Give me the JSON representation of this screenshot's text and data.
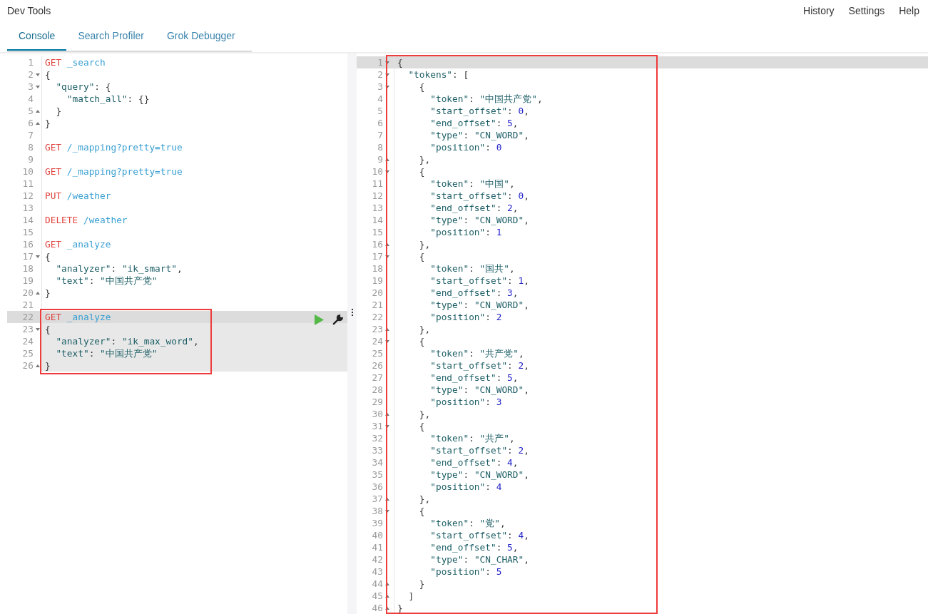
{
  "app": {
    "title": "Dev Tools",
    "links": [
      "History",
      "Settings",
      "Help"
    ]
  },
  "tabs": [
    {
      "label": "Console",
      "selected": true
    },
    {
      "label": "Search Profiler",
      "selected": false
    },
    {
      "label": "Grok Debugger",
      "selected": false
    }
  ],
  "editors": [
    {
      "kind": "input",
      "blocks": [
        {
          "highlighted": false,
          "boxed": false,
          "lines": [
            {
              "n": "1",
              "kind": "plain",
              "active": false,
              "segs": [
                {
                  "kind": "method",
                  "text": "GET"
                },
                {
                  "kind": "url",
                  "text": " _search"
                }
              ]
            },
            {
              "n": "2",
              "kind": "opener",
              "active": false,
              "segs": [
                {
                  "kind": "punct",
                  "text": "{"
                }
              ]
            },
            {
              "n": "3",
              "kind": "opener",
              "active": false,
              "segs": [
                {
                  "kind": "key",
                  "text": "  \"query\""
                },
                {
                  "kind": "punct",
                  "text": ": {"
                }
              ]
            },
            {
              "n": "4",
              "kind": "plain",
              "active": false,
              "segs": [
                {
                  "kind": "key",
                  "text": "    \"match_all\""
                },
                {
                  "kind": "punct",
                  "text": ": {}"
                }
              ]
            },
            {
              "n": "5",
              "kind": "closer",
              "active": false,
              "segs": [
                {
                  "kind": "punct",
                  "text": "  }"
                }
              ]
            },
            {
              "n": "6",
              "kind": "closer",
              "active": false,
              "segs": [
                {
                  "kind": "punct",
                  "text": "}"
                }
              ]
            },
            {
              "n": "7",
              "kind": "plain",
              "active": false
            },
            {
              "n": "8",
              "kind": "plain",
              "active": false,
              "segs": [
                {
                  "kind": "method",
                  "text": "GET"
                },
                {
                  "kind": "url",
                  "text": " /_mapping?pretty=true"
                }
              ]
            },
            {
              "n": "9",
              "kind": "plain",
              "active": false
            },
            {
              "n": "10",
              "kind": "plain",
              "active": false,
              "segs": [
                {
                  "kind": "method",
                  "text": "GET"
                },
                {
                  "kind": "url",
                  "text": " /_mapping?pretty=true"
                }
              ]
            },
            {
              "n": "11",
              "kind": "plain",
              "active": false
            },
            {
              "n": "12",
              "kind": "plain",
              "active": false,
              "segs": [
                {
                  "kind": "method",
                  "text": "PUT"
                },
                {
                  "kind": "url",
                  "text": " /weather"
                }
              ]
            },
            {
              "n": "13",
              "kind": "plain",
              "active": false
            },
            {
              "n": "14",
              "kind": "plain",
              "active": false,
              "segs": [
                {
                  "kind": "method",
                  "text": "DELETE"
                },
                {
                  "kind": "url",
                  "text": " /weather"
                }
              ]
            },
            {
              "n": "15",
              "kind": "plain",
              "active": false
            },
            {
              "n": "16",
              "kind": "plain",
              "active": false,
              "segs": [
                {
                  "kind": "method",
                  "text": "GET"
                },
                {
                  "kind": "url",
                  "text": " _analyze"
                }
              ]
            },
            {
              "n": "17",
              "kind": "opener",
              "active": false,
              "segs": [
                {
                  "kind": "punct",
                  "text": "{"
                }
              ]
            },
            {
              "n": "18",
              "kind": "plain",
              "active": false,
              "segs": [
                {
                  "kind": "key",
                  "text": "  \"analyzer\""
                },
                {
                  "kind": "punct",
                  "text": ": "
                },
                {
                  "kind": "string",
                  "text": "\"ik_smart\""
                },
                {
                  "kind": "punct",
                  "text": ","
                }
              ]
            },
            {
              "n": "19",
              "kind": "plain",
              "active": false,
              "segs": [
                {
                  "kind": "key",
                  "text": "  \"text\""
                },
                {
                  "kind": "punct",
                  "text": ": "
                },
                {
                  "kind": "string",
                  "text": "\"中国共产党\""
                }
              ]
            },
            {
              "n": "20",
              "kind": "closer",
              "active": false,
              "segs": [
                {
                  "kind": "punct",
                  "text": "}"
                }
              ]
            },
            {
              "n": "21",
              "kind": "plain",
              "active": false
            }
          ]
        },
        {
          "highlighted": true,
          "boxed": true,
          "lines": [
            {
              "n": "22",
              "kind": "plain",
              "active": true,
              "segs": [
                {
                  "kind": "method",
                  "text": "GET"
                },
                {
                  "kind": "url",
                  "text": " _analyze"
                }
              ]
            },
            {
              "n": "23",
              "kind": "opener",
              "active": false,
              "segs": [
                {
                  "kind": "punct",
                  "text": "{"
                }
              ]
            },
            {
              "n": "24",
              "kind": "plain",
              "active": false,
              "segs": [
                {
                  "kind": "key",
                  "text": "  \"analyzer\""
                },
                {
                  "kind": "punct",
                  "text": ": "
                },
                {
                  "kind": "string",
                  "text": "\"ik_max_word\""
                },
                {
                  "kind": "punct",
                  "text": ","
                }
              ]
            },
            {
              "n": "25",
              "kind": "plain",
              "active": false,
              "segs": [
                {
                  "kind": "key",
                  "text": "  \"text\""
                },
                {
                  "kind": "punct",
                  "text": ": "
                },
                {
                  "kind": "string",
                  "text": "\"中国共产党\""
                }
              ]
            },
            {
              "n": "26",
              "kind": "closer",
              "active": false,
              "segs": [
                {
                  "kind": "punct",
                  "text": "}"
                }
              ]
            }
          ]
        }
      ]
    },
    {
      "kind": "output",
      "blocks": [
        {
          "highlighted": false,
          "boxed": true,
          "lines": [
            {
              "n": "1",
              "kind": "opener",
              "active": true,
              "segs": [
                {
                  "kind": "punct",
                  "text": "{"
                }
              ]
            },
            {
              "n": "2",
              "kind": "opener",
              "active": false,
              "segs": [
                {
                  "kind": "key",
                  "text": "  \"tokens\""
                },
                {
                  "kind": "punct",
                  "text": ": ["
                }
              ]
            },
            {
              "n": "3",
              "kind": "opener",
              "active": false,
              "segs": [
                {
                  "kind": "punct",
                  "text": "    {"
                }
              ]
            },
            {
              "n": "4",
              "kind": "plain",
              "active": false,
              "segs": [
                {
                  "kind": "key",
                  "text": "      \"token\""
                },
                {
                  "kind": "punct",
                  "text": ": "
                },
                {
                  "kind": "string",
                  "text": "\"中国共产党\""
                },
                {
                  "kind": "punct",
                  "text": ","
                }
              ]
            },
            {
              "n": "5",
              "kind": "plain",
              "active": false,
              "segs": [
                {
                  "kind": "key",
                  "text": "      \"start_offset\""
                },
                {
                  "kind": "punct",
                  "text": ": "
                },
                {
                  "kind": "number",
                  "text": "0"
                },
                {
                  "kind": "punct",
                  "text": ","
                }
              ]
            },
            {
              "n": "6",
              "kind": "plain",
              "active": false,
              "segs": [
                {
                  "kind": "key",
                  "text": "      \"end_offset\""
                },
                {
                  "kind": "punct",
                  "text": ": "
                },
                {
                  "kind": "number",
                  "text": "5"
                },
                {
                  "kind": "punct",
                  "text": ","
                }
              ]
            },
            {
              "n": "7",
              "kind": "plain",
              "active": false,
              "segs": [
                {
                  "kind": "key",
                  "text": "      \"type\""
                },
                {
                  "kind": "punct",
                  "text": ": "
                },
                {
                  "kind": "string",
                  "text": "\"CN_WORD\""
                },
                {
                  "kind": "punct",
                  "text": ","
                }
              ]
            },
            {
              "n": "8",
              "kind": "plain",
              "active": false,
              "segs": [
                {
                  "kind": "key",
                  "text": "      \"position\""
                },
                {
                  "kind": "punct",
                  "text": ": "
                },
                {
                  "kind": "number",
                  "text": "0"
                }
              ]
            },
            {
              "n": "9",
              "kind": "closer",
              "active": false,
              "segs": [
                {
                  "kind": "punct",
                  "text": "    },"
                }
              ]
            },
            {
              "n": "10",
              "kind": "opener",
              "active": false,
              "segs": [
                {
                  "kind": "punct",
                  "text": "    {"
                }
              ]
            },
            {
              "n": "11",
              "kind": "plain",
              "active": false,
              "segs": [
                {
                  "kind": "key",
                  "text": "      \"token\""
                },
                {
                  "kind": "punct",
                  "text": ": "
                },
                {
                  "kind": "string",
                  "text": "\"中国\""
                },
                {
                  "kind": "punct",
                  "text": ","
                }
              ]
            },
            {
              "n": "12",
              "kind": "plain",
              "active": false,
              "segs": [
                {
                  "kind": "key",
                  "text": "      \"start_offset\""
                },
                {
                  "kind": "punct",
                  "text": ": "
                },
                {
                  "kind": "number",
                  "text": "0"
                },
                {
                  "kind": "punct",
                  "text": ","
                }
              ]
            },
            {
              "n": "13",
              "kind": "plain",
              "active": false,
              "segs": [
                {
                  "kind": "key",
                  "text": "      \"end_offset\""
                },
                {
                  "kind": "punct",
                  "text": ": "
                },
                {
                  "kind": "number",
                  "text": "2"
                },
                {
                  "kind": "punct",
                  "text": ","
                }
              ]
            },
            {
              "n": "14",
              "kind": "plain",
              "active": false,
              "segs": [
                {
                  "kind": "key",
                  "text": "      \"type\""
                },
                {
                  "kind": "punct",
                  "text": ": "
                },
                {
                  "kind": "string",
                  "text": "\"CN_WORD\""
                },
                {
                  "kind": "punct",
                  "text": ","
                }
              ]
            },
            {
              "n": "15",
              "kind": "plain",
              "active": false,
              "segs": [
                {
                  "kind": "key",
                  "text": "      \"position\""
                },
                {
                  "kind": "punct",
                  "text": ": "
                },
                {
                  "kind": "number",
                  "text": "1"
                }
              ]
            },
            {
              "n": "16",
              "kind": "closer",
              "active": false,
              "segs": [
                {
                  "kind": "punct",
                  "text": "    },"
                }
              ]
            },
            {
              "n": "17",
              "kind": "opener",
              "active": false,
              "segs": [
                {
                  "kind": "punct",
                  "text": "    {"
                }
              ]
            },
            {
              "n": "18",
              "kind": "plain",
              "active": false,
              "segs": [
                {
                  "kind": "key",
                  "text": "      \"token\""
                },
                {
                  "kind": "punct",
                  "text": ": "
                },
                {
                  "kind": "string",
                  "text": "\"国共\""
                },
                {
                  "kind": "punct",
                  "text": ","
                }
              ]
            },
            {
              "n": "19",
              "kind": "plain",
              "active": false,
              "segs": [
                {
                  "kind": "key",
                  "text": "      \"start_offset\""
                },
                {
                  "kind": "punct",
                  "text": ": "
                },
                {
                  "kind": "number",
                  "text": "1"
                },
                {
                  "kind": "punct",
                  "text": ","
                }
              ]
            },
            {
              "n": "20",
              "kind": "plain",
              "active": false,
              "segs": [
                {
                  "kind": "key",
                  "text": "      \"end_offset\""
                },
                {
                  "kind": "punct",
                  "text": ": "
                },
                {
                  "kind": "number",
                  "text": "3"
                },
                {
                  "kind": "punct",
                  "text": ","
                }
              ]
            },
            {
              "n": "21",
              "kind": "plain",
              "active": false,
              "segs": [
                {
                  "kind": "key",
                  "text": "      \"type\""
                },
                {
                  "kind": "punct",
                  "text": ": "
                },
                {
                  "kind": "string",
                  "text": "\"CN_WORD\""
                },
                {
                  "kind": "punct",
                  "text": ","
                }
              ]
            },
            {
              "n": "22",
              "kind": "plain",
              "active": false,
              "segs": [
                {
                  "kind": "key",
                  "text": "      \"position\""
                },
                {
                  "kind": "punct",
                  "text": ": "
                },
                {
                  "kind": "number",
                  "text": "2"
                }
              ]
            },
            {
              "n": "23",
              "kind": "closer",
              "active": false,
              "segs": [
                {
                  "kind": "punct",
                  "text": "    },"
                }
              ]
            },
            {
              "n": "24",
              "kind": "opener",
              "active": false,
              "segs": [
                {
                  "kind": "punct",
                  "text": "    {"
                }
              ]
            },
            {
              "n": "25",
              "kind": "plain",
              "active": false,
              "segs": [
                {
                  "kind": "key",
                  "text": "      \"token\""
                },
                {
                  "kind": "punct",
                  "text": ": "
                },
                {
                  "kind": "string",
                  "text": "\"共产党\""
                },
                {
                  "kind": "punct",
                  "text": ","
                }
              ]
            },
            {
              "n": "26",
              "kind": "plain",
              "active": false,
              "segs": [
                {
                  "kind": "key",
                  "text": "      \"start_offset\""
                },
                {
                  "kind": "punct",
                  "text": ": "
                },
                {
                  "kind": "number",
                  "text": "2"
                },
                {
                  "kind": "punct",
                  "text": ","
                }
              ]
            },
            {
              "n": "27",
              "kind": "plain",
              "active": false,
              "segs": [
                {
                  "kind": "key",
                  "text": "      \"end_offset\""
                },
                {
                  "kind": "punct",
                  "text": ": "
                },
                {
                  "kind": "number",
                  "text": "5"
                },
                {
                  "kind": "punct",
                  "text": ","
                }
              ]
            },
            {
              "n": "28",
              "kind": "plain",
              "active": false,
              "segs": [
                {
                  "kind": "key",
                  "text": "      \"type\""
                },
                {
                  "kind": "punct",
                  "text": ": "
                },
                {
                  "kind": "string",
                  "text": "\"CN_WORD\""
                },
                {
                  "kind": "punct",
                  "text": ","
                }
              ]
            },
            {
              "n": "29",
              "kind": "plain",
              "active": false,
              "segs": [
                {
                  "kind": "key",
                  "text": "      \"position\""
                },
                {
                  "kind": "punct",
                  "text": ": "
                },
                {
                  "kind": "number",
                  "text": "3"
                }
              ]
            },
            {
              "n": "30",
              "kind": "closer",
              "active": false,
              "segs": [
                {
                  "kind": "punct",
                  "text": "    },"
                }
              ]
            },
            {
              "n": "31",
              "kind": "opener",
              "active": false,
              "segs": [
                {
                  "kind": "punct",
                  "text": "    {"
                }
              ]
            },
            {
              "n": "32",
              "kind": "plain",
              "active": false,
              "segs": [
                {
                  "kind": "key",
                  "text": "      \"token\""
                },
                {
                  "kind": "punct",
                  "text": ": "
                },
                {
                  "kind": "string",
                  "text": "\"共产\""
                },
                {
                  "kind": "punct",
                  "text": ","
                }
              ]
            },
            {
              "n": "33",
              "kind": "plain",
              "active": false,
              "segs": [
                {
                  "kind": "key",
                  "text": "      \"start_offset\""
                },
                {
                  "kind": "punct",
                  "text": ": "
                },
                {
                  "kind": "number",
                  "text": "2"
                },
                {
                  "kind": "punct",
                  "text": ","
                }
              ]
            },
            {
              "n": "34",
              "kind": "plain",
              "active": false,
              "segs": [
                {
                  "kind": "key",
                  "text": "      \"end_offset\""
                },
                {
                  "kind": "punct",
                  "text": ": "
                },
                {
                  "kind": "number",
                  "text": "4"
                },
                {
                  "kind": "punct",
                  "text": ","
                }
              ]
            },
            {
              "n": "35",
              "kind": "plain",
              "active": false,
              "segs": [
                {
                  "kind": "key",
                  "text": "      \"type\""
                },
                {
                  "kind": "punct",
                  "text": ": "
                },
                {
                  "kind": "string",
                  "text": "\"CN_WORD\""
                },
                {
                  "kind": "punct",
                  "text": ","
                }
              ]
            },
            {
              "n": "36",
              "kind": "plain",
              "active": false,
              "segs": [
                {
                  "kind": "key",
                  "text": "      \"position\""
                },
                {
                  "kind": "punct",
                  "text": ": "
                },
                {
                  "kind": "number",
                  "text": "4"
                }
              ]
            },
            {
              "n": "37",
              "kind": "closer",
              "active": false,
              "segs": [
                {
                  "kind": "punct",
                  "text": "    },"
                }
              ]
            },
            {
              "n": "38",
              "kind": "opener",
              "active": false,
              "segs": [
                {
                  "kind": "punct",
                  "text": "    {"
                }
              ]
            },
            {
              "n": "39",
              "kind": "plain",
              "active": false,
              "segs": [
                {
                  "kind": "key",
                  "text": "      \"token\""
                },
                {
                  "kind": "punct",
                  "text": ": "
                },
                {
                  "kind": "string",
                  "text": "\"党\""
                },
                {
                  "kind": "punct",
                  "text": ","
                }
              ]
            },
            {
              "n": "40",
              "kind": "plain",
              "active": false,
              "segs": [
                {
                  "kind": "key",
                  "text": "      \"start_offset\""
                },
                {
                  "kind": "punct",
                  "text": ": "
                },
                {
                  "kind": "number",
                  "text": "4"
                },
                {
                  "kind": "punct",
                  "text": ","
                }
              ]
            },
            {
              "n": "41",
              "kind": "plain",
              "active": false,
              "segs": [
                {
                  "kind": "key",
                  "text": "      \"end_offset\""
                },
                {
                  "kind": "punct",
                  "text": ": "
                },
                {
                  "kind": "number",
                  "text": "5"
                },
                {
                  "kind": "punct",
                  "text": ","
                }
              ]
            },
            {
              "n": "42",
              "kind": "plain",
              "active": false,
              "segs": [
                {
                  "kind": "key",
                  "text": "      \"type\""
                },
                {
                  "kind": "punct",
                  "text": ": "
                },
                {
                  "kind": "string",
                  "text": "\"CN_CHAR\""
                },
                {
                  "kind": "punct",
                  "text": ","
                }
              ]
            },
            {
              "n": "43",
              "kind": "plain",
              "active": false,
              "segs": [
                {
                  "kind": "key",
                  "text": "      \"position\""
                },
                {
                  "kind": "punct",
                  "text": ": "
                },
                {
                  "kind": "number",
                  "text": "5"
                }
              ]
            },
            {
              "n": "44",
              "kind": "closer",
              "active": false,
              "segs": [
                {
                  "kind": "punct",
                  "text": "    }"
                }
              ]
            },
            {
              "n": "45",
              "kind": "closer",
              "active": false,
              "segs": [
                {
                  "kind": "punct",
                  "text": "  ]"
                }
              ]
            },
            {
              "n": "46",
              "kind": "closer",
              "active": false,
              "segs": [
                {
                  "kind": "punct",
                  "text": "}"
                }
              ]
            }
          ]
        }
      ]
    }
  ]
}
